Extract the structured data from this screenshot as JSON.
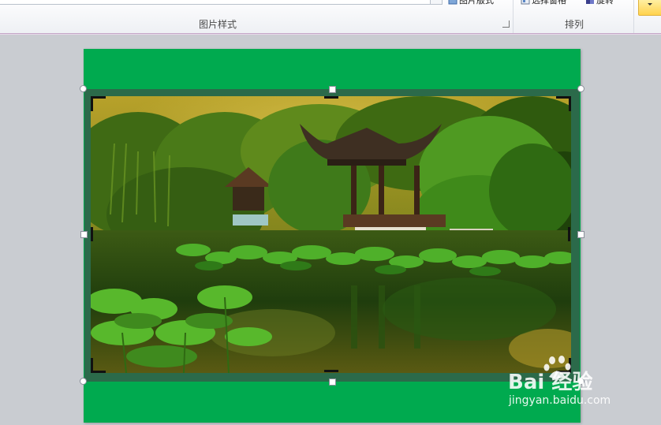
{
  "ribbon": {
    "picture_layout_label": "图片版式",
    "picture_styles_group": "图片样式",
    "arrange_group": "排列",
    "selection_pane_label": "选择窗格",
    "rotate_label": "旋转"
  },
  "watermark": {
    "brand": "Bai  经验",
    "site": "jingyan.baidu.com"
  },
  "colors": {
    "slide_background": "#00aa4f",
    "picture_border": "#2b6a4a",
    "ribbon_group_border": "#c4a7c7"
  }
}
